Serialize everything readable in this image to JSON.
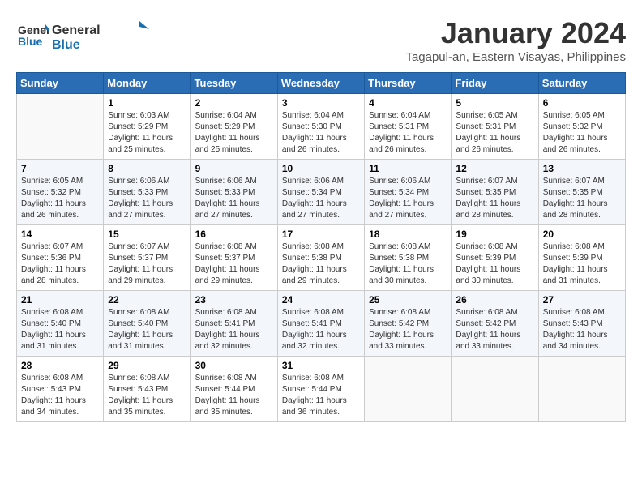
{
  "logo": {
    "general": "General",
    "blue": "Blue"
  },
  "title": "January 2024",
  "subtitle": "Tagapul-an, Eastern Visayas, Philippines",
  "days_of_week": [
    "Sunday",
    "Monday",
    "Tuesday",
    "Wednesday",
    "Thursday",
    "Friday",
    "Saturday"
  ],
  "weeks": [
    [
      {
        "day": "",
        "info": ""
      },
      {
        "day": "1",
        "info": "Sunrise: 6:03 AM\nSunset: 5:29 PM\nDaylight: 11 hours\nand 25 minutes."
      },
      {
        "day": "2",
        "info": "Sunrise: 6:04 AM\nSunset: 5:29 PM\nDaylight: 11 hours\nand 25 minutes."
      },
      {
        "day": "3",
        "info": "Sunrise: 6:04 AM\nSunset: 5:30 PM\nDaylight: 11 hours\nand 26 minutes."
      },
      {
        "day": "4",
        "info": "Sunrise: 6:04 AM\nSunset: 5:31 PM\nDaylight: 11 hours\nand 26 minutes."
      },
      {
        "day": "5",
        "info": "Sunrise: 6:05 AM\nSunset: 5:31 PM\nDaylight: 11 hours\nand 26 minutes."
      },
      {
        "day": "6",
        "info": "Sunrise: 6:05 AM\nSunset: 5:32 PM\nDaylight: 11 hours\nand 26 minutes."
      }
    ],
    [
      {
        "day": "7",
        "info": "Sunrise: 6:05 AM\nSunset: 5:32 PM\nDaylight: 11 hours\nand 26 minutes."
      },
      {
        "day": "8",
        "info": "Sunrise: 6:06 AM\nSunset: 5:33 PM\nDaylight: 11 hours\nand 27 minutes."
      },
      {
        "day": "9",
        "info": "Sunrise: 6:06 AM\nSunset: 5:33 PM\nDaylight: 11 hours\nand 27 minutes."
      },
      {
        "day": "10",
        "info": "Sunrise: 6:06 AM\nSunset: 5:34 PM\nDaylight: 11 hours\nand 27 minutes."
      },
      {
        "day": "11",
        "info": "Sunrise: 6:06 AM\nSunset: 5:34 PM\nDaylight: 11 hours\nand 27 minutes."
      },
      {
        "day": "12",
        "info": "Sunrise: 6:07 AM\nSunset: 5:35 PM\nDaylight: 11 hours\nand 28 minutes."
      },
      {
        "day": "13",
        "info": "Sunrise: 6:07 AM\nSunset: 5:35 PM\nDaylight: 11 hours\nand 28 minutes."
      }
    ],
    [
      {
        "day": "14",
        "info": "Sunrise: 6:07 AM\nSunset: 5:36 PM\nDaylight: 11 hours\nand 28 minutes."
      },
      {
        "day": "15",
        "info": "Sunrise: 6:07 AM\nSunset: 5:37 PM\nDaylight: 11 hours\nand 29 minutes."
      },
      {
        "day": "16",
        "info": "Sunrise: 6:08 AM\nSunset: 5:37 PM\nDaylight: 11 hours\nand 29 minutes."
      },
      {
        "day": "17",
        "info": "Sunrise: 6:08 AM\nSunset: 5:38 PM\nDaylight: 11 hours\nand 29 minutes."
      },
      {
        "day": "18",
        "info": "Sunrise: 6:08 AM\nSunset: 5:38 PM\nDaylight: 11 hours\nand 30 minutes."
      },
      {
        "day": "19",
        "info": "Sunrise: 6:08 AM\nSunset: 5:39 PM\nDaylight: 11 hours\nand 30 minutes."
      },
      {
        "day": "20",
        "info": "Sunrise: 6:08 AM\nSunset: 5:39 PM\nDaylight: 11 hours\nand 31 minutes."
      }
    ],
    [
      {
        "day": "21",
        "info": "Sunrise: 6:08 AM\nSunset: 5:40 PM\nDaylight: 11 hours\nand 31 minutes."
      },
      {
        "day": "22",
        "info": "Sunrise: 6:08 AM\nSunset: 5:40 PM\nDaylight: 11 hours\nand 31 minutes."
      },
      {
        "day": "23",
        "info": "Sunrise: 6:08 AM\nSunset: 5:41 PM\nDaylight: 11 hours\nand 32 minutes."
      },
      {
        "day": "24",
        "info": "Sunrise: 6:08 AM\nSunset: 5:41 PM\nDaylight: 11 hours\nand 32 minutes."
      },
      {
        "day": "25",
        "info": "Sunrise: 6:08 AM\nSunset: 5:42 PM\nDaylight: 11 hours\nand 33 minutes."
      },
      {
        "day": "26",
        "info": "Sunrise: 6:08 AM\nSunset: 5:42 PM\nDaylight: 11 hours\nand 33 minutes."
      },
      {
        "day": "27",
        "info": "Sunrise: 6:08 AM\nSunset: 5:43 PM\nDaylight: 11 hours\nand 34 minutes."
      }
    ],
    [
      {
        "day": "28",
        "info": "Sunrise: 6:08 AM\nSunset: 5:43 PM\nDaylight: 11 hours\nand 34 minutes."
      },
      {
        "day": "29",
        "info": "Sunrise: 6:08 AM\nSunset: 5:43 PM\nDaylight: 11 hours\nand 35 minutes."
      },
      {
        "day": "30",
        "info": "Sunrise: 6:08 AM\nSunset: 5:44 PM\nDaylight: 11 hours\nand 35 minutes."
      },
      {
        "day": "31",
        "info": "Sunrise: 6:08 AM\nSunset: 5:44 PM\nDaylight: 11 hours\nand 36 minutes."
      },
      {
        "day": "",
        "info": ""
      },
      {
        "day": "",
        "info": ""
      },
      {
        "day": "",
        "info": ""
      }
    ]
  ]
}
